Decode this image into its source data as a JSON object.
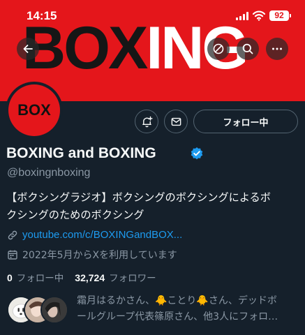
{
  "status_bar": {
    "time": "14:15",
    "battery": "92"
  },
  "banner": {
    "word_dark": "BOX",
    "word_light": "ING"
  },
  "avatar": {
    "text": "BOX"
  },
  "profile": {
    "display_name": "BOXING and BOXING",
    "handle": "@boxingnboxing",
    "bio_line1": "【ボクシングラジオ】ボクシングのボクシングによるボ",
    "bio_line2": "クシングのためのボクシング",
    "link": "youtube.com/c/BOXINGandBOX...",
    "joined": "2022年5月からXを利用しています"
  },
  "actions": {
    "follow_label": "フォロー中"
  },
  "stats": {
    "following_count": "0",
    "following_label": "フォロー中",
    "followers_count": "32,724",
    "followers_label": "フォロワー"
  },
  "known_followers": {
    "line1": "霜月はるかさん、🐥ことり🐥さん、デッドボ",
    "line2": "ールグループ代表篠原さん、他3人にフォロ…"
  },
  "colors": {
    "banner_red": "#e4161b",
    "background": "#15202b",
    "link_blue": "#1d9bf0",
    "muted_text": "#8b98a5"
  },
  "icons": [
    "back-arrow-icon",
    "ban-icon",
    "search-icon",
    "more-icon",
    "bell-plus-icon",
    "mail-icon",
    "verified-badge-icon",
    "link-icon",
    "calendar-icon"
  ]
}
